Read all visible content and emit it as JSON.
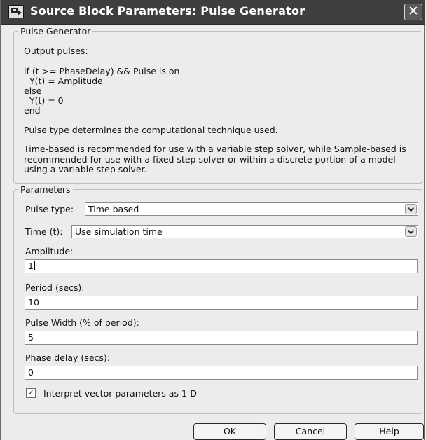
{
  "window": {
    "title": "Source Block Parameters: Pulse Generator",
    "close_glyph": "✕"
  },
  "description_group": {
    "legend": "Pulse Generator",
    "output_line": "Output pulses:",
    "code_lines": [
      "if (t >= PhaseDelay) && Pulse is on",
      "  Y(t) = Amplitude",
      "else",
      "  Y(t) = 0",
      "end"
    ],
    "note1": "Pulse type determines the computational technique used.",
    "note2": "Time-based is recommended for use with a variable step solver, while Sample-based is recommended for use with a fixed step solver or within a discrete portion of a model using a variable step solver."
  },
  "parameters": {
    "legend": "Parameters",
    "pulse_type": {
      "label": "Pulse type:",
      "value": "Time based"
    },
    "time": {
      "label": "Time (t):",
      "value": "Use simulation time"
    },
    "amplitude": {
      "label": "Amplitude:",
      "value": "1"
    },
    "period": {
      "label": "Period (secs):",
      "value": "10"
    },
    "pulse_width": {
      "label": "Pulse Width (% of period):",
      "value": "5"
    },
    "phase_delay": {
      "label": "Phase delay (secs):",
      "value": "0"
    },
    "interpret_vector": {
      "label": "Interpret vector parameters as 1-D",
      "checked": true,
      "check_glyph": "✓"
    }
  },
  "buttons": {
    "ok": "OK",
    "cancel": "Cancel",
    "help": "Help"
  },
  "icons": {
    "app": "simulink-block-icon",
    "dropdown": "chevron-down-icon",
    "close": "close-icon"
  },
  "colors": {
    "titlebar": "#3f3f3f",
    "dialog_bg": "#ececec"
  }
}
